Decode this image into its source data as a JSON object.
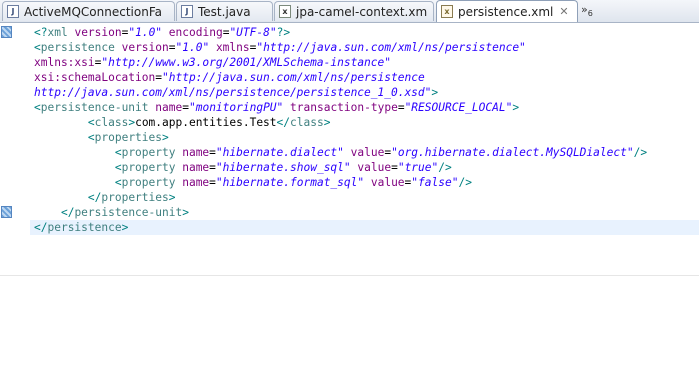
{
  "tabs": [
    {
      "label": "ActiveMQConnectionFa",
      "icon": "java-file-icon"
    },
    {
      "label": "Test.java",
      "icon": "java-file-icon"
    },
    {
      "label": "jpa-camel-context.xm",
      "icon": "xml-file-icon"
    },
    {
      "label": "persistence.xml",
      "icon": "xml-file-icon",
      "active": true,
      "close": "✕"
    }
  ],
  "overflow": {
    "symbol": "»",
    "count": "6"
  },
  "code": [
    [
      [
        "b",
        "<?"
      ],
      [
        "t",
        "xml"
      ],
      [
        "x",
        " "
      ],
      [
        "a",
        "version"
      ],
      [
        "x",
        "="
      ],
      [
        "v",
        "\"1.0\""
      ],
      [
        "x",
        " "
      ],
      [
        "a",
        "encoding"
      ],
      [
        "x",
        "="
      ],
      [
        "v",
        "\"UTF-8\""
      ],
      [
        "b",
        "?>"
      ]
    ],
    [
      [
        "b",
        "<"
      ],
      [
        "t",
        "persistence"
      ],
      [
        "x",
        " "
      ],
      [
        "a",
        "version"
      ],
      [
        "x",
        "="
      ],
      [
        "v",
        "\"1.0\""
      ],
      [
        "x",
        " "
      ],
      [
        "a",
        "xmlns"
      ],
      [
        "x",
        "="
      ],
      [
        "v",
        "\"http://java.sun.com/xml/ns/persistence\""
      ]
    ],
    [
      [
        "a",
        "xmlns:xsi"
      ],
      [
        "x",
        "="
      ],
      [
        "v",
        "\"http://www.w3.org/2001/XMLSchema-instance\""
      ]
    ],
    [
      [
        "a",
        "xsi:schemaLocation"
      ],
      [
        "x",
        "="
      ],
      [
        "v",
        "\"http://java.sun.com/xml/ns/persistence"
      ]
    ],
    [
      [
        "v",
        "http://java.sun.com/xml/ns/persistence/persistence_1_0.xsd\""
      ],
      [
        "b",
        ">"
      ]
    ],
    [
      [
        "b",
        "<"
      ],
      [
        "t",
        "persistence-unit"
      ],
      [
        "x",
        " "
      ],
      [
        "a",
        "name"
      ],
      [
        "x",
        "="
      ],
      [
        "v",
        "\"monitoringPU\""
      ],
      [
        "x",
        " "
      ],
      [
        "a",
        "transaction-type"
      ],
      [
        "x",
        "="
      ],
      [
        "v",
        "\"RESOURCE_LOCAL\""
      ],
      [
        "b",
        ">"
      ]
    ],
    [
      [
        "x",
        "        "
      ],
      [
        "b",
        "<"
      ],
      [
        "t",
        "class"
      ],
      [
        "b",
        ">"
      ],
      [
        "x",
        "com.app.entities.Test"
      ],
      [
        "b",
        "</"
      ],
      [
        "t",
        "class"
      ],
      [
        "b",
        ">"
      ]
    ],
    [
      [
        "x",
        "        "
      ],
      [
        "b",
        "<"
      ],
      [
        "t",
        "properties"
      ],
      [
        "b",
        ">"
      ]
    ],
    [
      [
        "x",
        "            "
      ],
      [
        "b",
        "<"
      ],
      [
        "t",
        "property"
      ],
      [
        "x",
        " "
      ],
      [
        "a",
        "name"
      ],
      [
        "x",
        "="
      ],
      [
        "v",
        "\"hibernate.dialect\""
      ],
      [
        "x",
        " "
      ],
      [
        "a",
        "value"
      ],
      [
        "x",
        "="
      ],
      [
        "v",
        "\"org.hibernate.dialect.MySQLDialect\""
      ],
      [
        "b",
        "/>"
      ]
    ],
    [
      [
        "x",
        "            "
      ],
      [
        "b",
        "<"
      ],
      [
        "t",
        "property"
      ],
      [
        "x",
        " "
      ],
      [
        "a",
        "name"
      ],
      [
        "x",
        "="
      ],
      [
        "v",
        "\"hibernate.show_sql\""
      ],
      [
        "x",
        " "
      ],
      [
        "a",
        "value"
      ],
      [
        "x",
        "="
      ],
      [
        "v",
        "\"true\""
      ],
      [
        "b",
        "/>"
      ]
    ],
    [
      [
        "x",
        "            "
      ],
      [
        "b",
        "<"
      ],
      [
        "t",
        "property"
      ],
      [
        "x",
        " "
      ],
      [
        "a",
        "name"
      ],
      [
        "x",
        "="
      ],
      [
        "v",
        "\"hibernate.format_sql\""
      ],
      [
        "x",
        " "
      ],
      [
        "a",
        "value"
      ],
      [
        "x",
        "="
      ],
      [
        "v",
        "\"false\""
      ],
      [
        "b",
        "/>"
      ]
    ],
    [
      [
        "x",
        "        "
      ],
      [
        "b",
        "</"
      ],
      [
        "t",
        "properties"
      ],
      [
        "b",
        ">"
      ]
    ],
    [
      [
        "x",
        "    "
      ],
      [
        "b",
        "</"
      ],
      [
        "t",
        "persistence-unit"
      ],
      [
        "b",
        ">"
      ]
    ],
    [
      [
        "b",
        "</"
      ],
      [
        "t",
        "persistence"
      ],
      [
        "b",
        ">"
      ]
    ]
  ],
  "ruler_markers": [
    1,
    13
  ]
}
